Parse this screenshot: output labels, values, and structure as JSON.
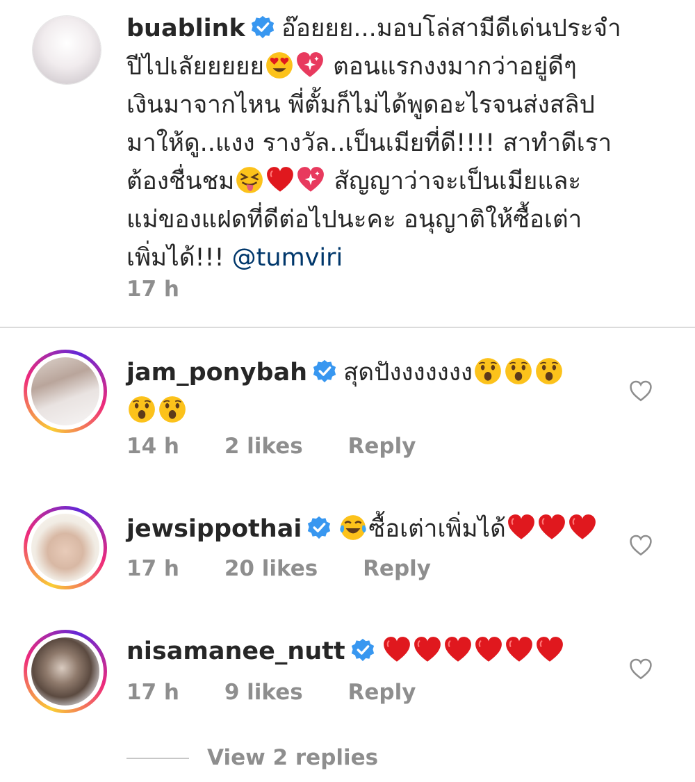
{
  "post": {
    "username": "buablink",
    "lines": [
      "อ๊อยยย...มอบโล่สามีดีเด่นประจำ",
      "ปีไปเลัยยยยย",
      "ตอนแรกงงมากว่าอยู่ดีๆ",
      "เงินมาจากไหน พี่ตั้มก็ไม่ได้พูดอะไรจนส่งสลิป",
      "มาให้ดู..แงง รางวัล..เป็นเมียที่ดี!!!! สาทำดีเรา",
      "ต้องชื่นชม",
      "สัญญาว่าจะเป็นเมียและ",
      "แม่ของแฝดที่ดีต่อไปนะคะ อนุญาติให้ซื้อเต่า",
      "เพิ่มได้!!!"
    ],
    "mention": "@tumviri",
    "time": "17 h"
  },
  "comments": [
    {
      "username": "jam_ponybah",
      "text": "สุดปังงงงงงง",
      "time": "14 h",
      "likes": "2 likes",
      "reply": "Reply"
    },
    {
      "username": "jewsippothai",
      "text": "ซื้อเต่าเพิ่มได้",
      "time": "17 h",
      "likes": "20 likes",
      "reply": "Reply"
    },
    {
      "username": "nisamanee_nutt",
      "text": "",
      "time": "17 h",
      "likes": "9 likes",
      "reply": "Reply"
    }
  ],
  "view_replies": "View 2 replies",
  "icons": {
    "verified": "verified-badge-icon",
    "like": "heart-outline-icon",
    "emoji_heart_eyes": "heart-eyes-emoji",
    "emoji_sparkle_heart": "sparkling-heart-emoji",
    "emoji_tongue": "squinting-tongue-emoji",
    "emoji_red_heart": "red-heart-emoji",
    "emoji_surprised": "surprised-face-emoji",
    "emoji_joy": "tears-of-joy-emoji"
  },
  "colors": {
    "text": "#262626",
    "meta": "#8e8e8e",
    "mention": "#00376b",
    "verified": "#3897f0",
    "heart": "#e0181e"
  }
}
